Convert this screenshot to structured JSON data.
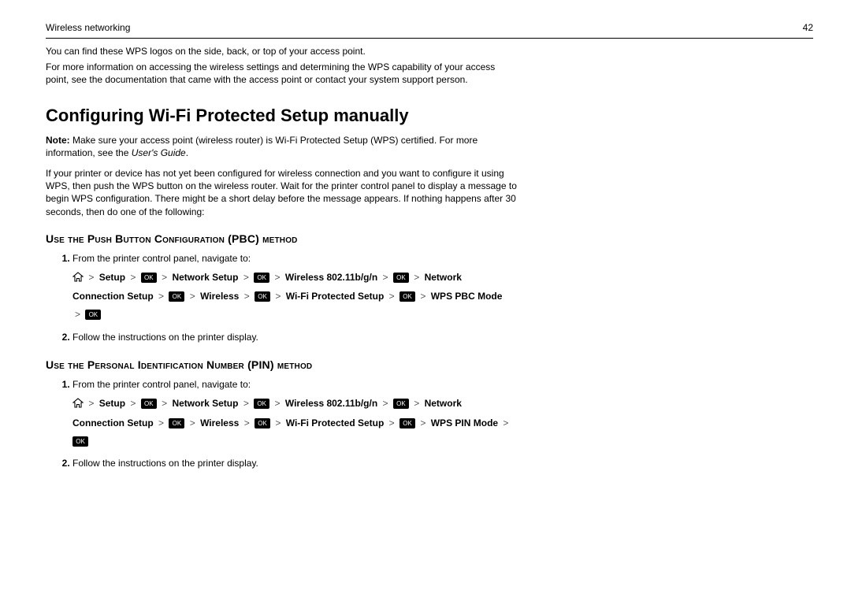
{
  "header": {
    "section": "Wireless networking",
    "page_number": "42"
  },
  "intro": {
    "line1": "You can find these WPS logos on the side, back, or top of your access point.",
    "line2": "For more information on accessing the wireless settings and determining the WPS capability of your access point, see the documentation that came with the access point or contact your system support person."
  },
  "title": "Configuring Wi‑Fi Protected Setup manually",
  "note": {
    "label": "Note:",
    "text": " Make sure your access point (wireless router) is Wi‑Fi Protected Setup (WPS) certified. For more information, see the ",
    "italic": "User's Guide",
    "period": "."
  },
  "after_note": "If your printer or device has not yet been configured for wireless connection and you want to configure it using WPS, then push the WPS button on the wireless router. Wait for the printer control panel to display a message to begin WPS configuration. There might be a short delay before the message appears. If nothing happens after 30 seconds, then do one of the following:",
  "pbc": {
    "heading": "Use the Push Button Configuration (PBC) method",
    "step1": "From the printer control panel, navigate to:",
    "step2": "Follow the instructions on the printer display.",
    "nav": {
      "gt": ">",
      "setup": "Setup",
      "ok": "OK",
      "network_setup": "Network Setup",
      "wireless_std": "Wireless 802.11b/g/n",
      "network_connection_setup": "Network Connection Setup",
      "wireless": "Wireless",
      "wps": "Wi‑Fi Protected Setup",
      "mode": "WPS PBC Mode"
    }
  },
  "pin": {
    "heading": "Use the Personal Identification Number (PIN) method",
    "step1": "From the printer control panel, navigate to:",
    "step2": "Follow the instructions on the printer display.",
    "nav": {
      "gt": ">",
      "setup": "Setup",
      "ok": "OK",
      "network_setup": "Network Setup",
      "wireless_std": "Wireless 802.11b/g/n",
      "network_connection_setup": "Network Connection Setup",
      "wireless": "Wireless",
      "wps": "Wi‑Fi Protected Setup",
      "mode": "WPS PIN Mode"
    }
  }
}
